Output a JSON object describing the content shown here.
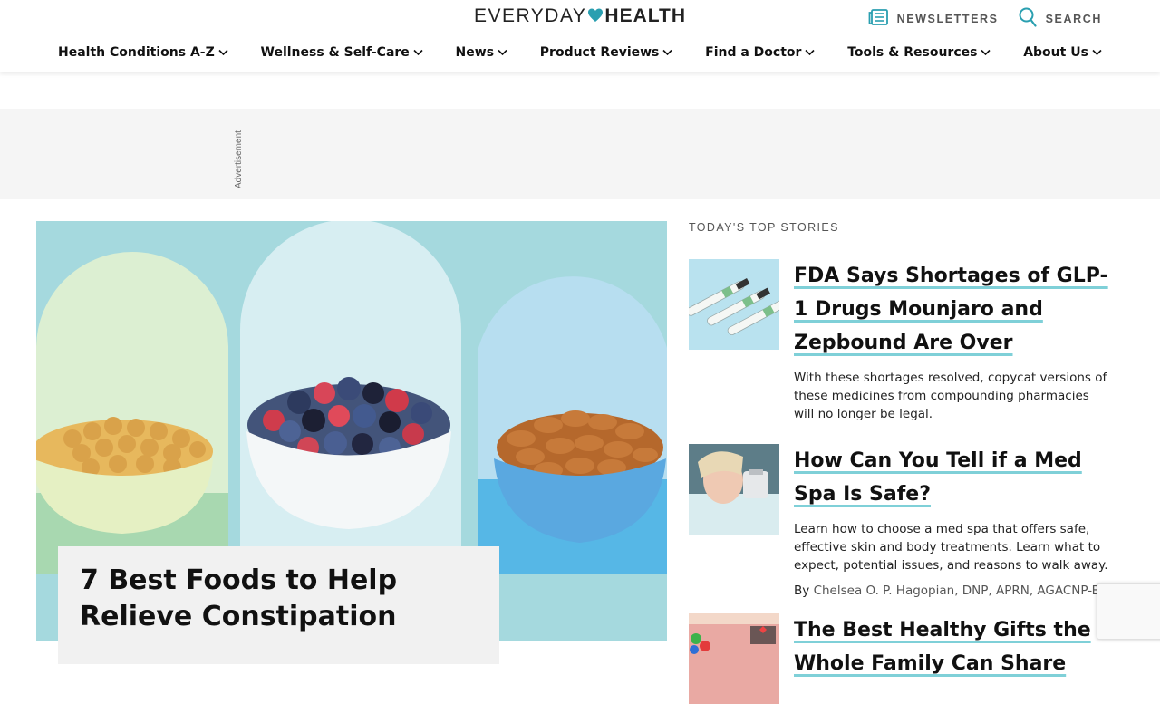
{
  "header": {
    "logo_left": "EVERYDAY",
    "logo_right": "HEALTH",
    "newsletters_label": "NEWSLETTERS",
    "search_label": "SEARCH"
  },
  "nav": {
    "items": [
      {
        "label": "Health Conditions A-Z"
      },
      {
        "label": "Wellness & Self-Care"
      },
      {
        "label": "News"
      },
      {
        "label": "Product Reviews"
      },
      {
        "label": "Find a Doctor"
      },
      {
        "label": "Tools & Resources"
      },
      {
        "label": "About Us"
      }
    ]
  },
  "ad": {
    "label": "Advertisement"
  },
  "hero": {
    "title": "7 Best Foods to Help Relieve Constipation"
  },
  "top_stories": {
    "label": "TODAY'S TOP STORIES",
    "items": [
      {
        "title": "FDA Says Shortages of GLP-1 Drugs Mounjaro and Zepbound Are Over",
        "description": "With these shortages resolved, copycat versions of these medicines from compounding pharmacies will no longer be legal."
      },
      {
        "title": "How Can You Tell if a Med Spa Is Safe?",
        "description": "Learn how to choose a med spa that offers safe, effective skin and body treatments. Learn what to expect, potential issues, and reasons to walk away.",
        "byline_prefix": "By",
        "author": "Chelsea O. P. Hagopian, DNP, APRN, AGACNP-BC"
      },
      {
        "title": "The Best Healthy Gifts the Whole Family Can Share"
      }
    ]
  },
  "colors": {
    "accent_teal": "#2a9fb0",
    "link_underline": "#7fd0d8",
    "hero_bg": "#a5d9de"
  }
}
